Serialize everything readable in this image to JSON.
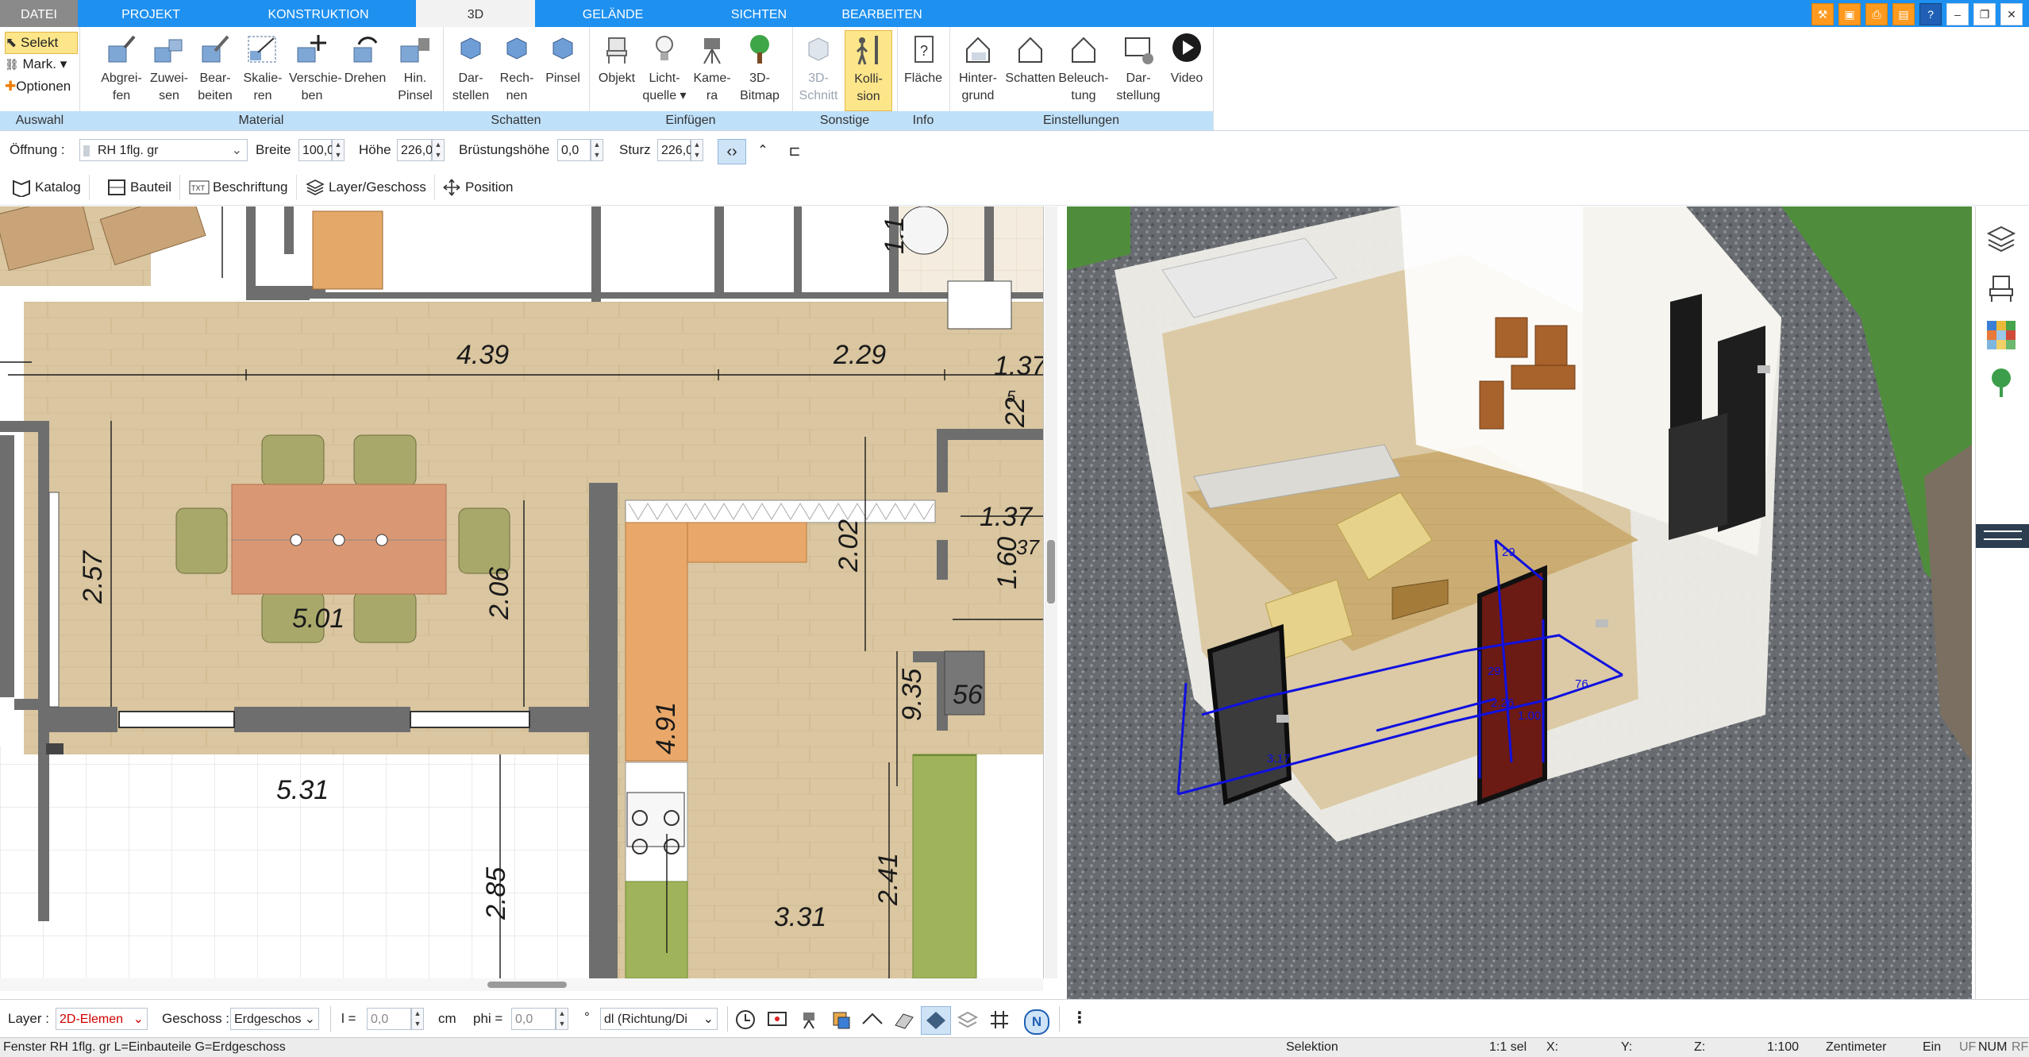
{
  "tabs": [
    "DATEI",
    "PROJEKT",
    "KONSTRUKTION",
    "3D",
    "GELÄNDE",
    "SICHTEN",
    "BEARBEITEN"
  ],
  "active_tab": "3D",
  "ribbon": {
    "auswahl": {
      "title": "Auswahl",
      "items": [
        "Selekt",
        "Mark.",
        "Optionen"
      ]
    },
    "material": {
      "title": "Material",
      "buttons": [
        {
          "l1": "Abgrei-",
          "l2": "fen"
        },
        {
          "l1": "Zuwei-",
          "l2": "sen"
        },
        {
          "l1": "Bear-",
          "l2": "beiten"
        },
        {
          "l1": "Skalie-",
          "l2": "ren"
        },
        {
          "l1": "Verschie-",
          "l2": "ben"
        },
        {
          "l1": "Drehen",
          "l2": ""
        },
        {
          "l1": "Hin.",
          "l2": "Pinsel"
        }
      ]
    },
    "schatten": {
      "title": "Schatten",
      "buttons": [
        {
          "l1": "Dar-",
          "l2": "stellen"
        },
        {
          "l1": "Rech-",
          "l2": "nen"
        },
        {
          "l1": "Pinsel",
          "l2": ""
        }
      ]
    },
    "einfuegen": {
      "title": "Einfügen",
      "buttons": [
        {
          "l1": "Objekt",
          "l2": ""
        },
        {
          "l1": "Licht-",
          "l2": "quelle ▾"
        },
        {
          "l1": "Kame-",
          "l2": "ra"
        },
        {
          "l1": "3D-",
          "l2": "Bitmap"
        }
      ]
    },
    "sonstige": {
      "title": "Sonstige",
      "buttons": [
        {
          "l1": "3D-",
          "l2": "Schnitt"
        },
        {
          "l1": "Kolli-",
          "l2": "sion"
        }
      ]
    },
    "info": {
      "title": "Info",
      "buttons": [
        {
          "l1": "Fläche",
          "l2": ""
        }
      ]
    },
    "einstellungen": {
      "title": "Einstellungen",
      "buttons": [
        {
          "l1": "Hinter-",
          "l2": "grund"
        },
        {
          "l1": "Schatten",
          "l2": ""
        },
        {
          "l1": "Beleuch-",
          "l2": "tung"
        },
        {
          "l1": "Dar-",
          "l2": "stellung"
        },
        {
          "l1": "Video",
          "l2": ""
        }
      ]
    }
  },
  "optbar": {
    "oeffnung_label": "Öffnung :",
    "oeffnung_value": "RH 1flg. gr",
    "breite_label": "Breite",
    "breite_value": "100,0",
    "hoehe_label": "Höhe",
    "hoehe_value": "226,0",
    "bruestung_label": "Brüstungshöhe",
    "bruestung_value": "0,0",
    "sturz_label": "Sturz",
    "sturz_value": "226,0"
  },
  "toolbar2": [
    "Katalog",
    "Bauteil",
    "Beschriftung",
    "Layer/Geschoss",
    "Position"
  ],
  "plan_dims": {
    "d1": "4.39",
    "d2": "2.29",
    "d3": "1.37",
    "d4": "2.57",
    "d5": "5.01",
    "d6": "2.06",
    "d7": "2.02",
    "d8": "1.37",
    "d9": "1.60",
    "d10": "5.31",
    "d11": "4.91",
    "d12": "9.35",
    "d13": "56",
    "d14": "2.85",
    "d15": "2.41",
    "d16": "3.31",
    "d17": "22",
    "d18": "5",
    "d19": "37",
    "d20": "1.1"
  },
  "view3d_dims": {
    "a": "3.17",
    "b": "1.00",
    "c": "2.26",
    "d": "29",
    "e": "76",
    "f": "29"
  },
  "bottom": {
    "layer_label": "Layer :",
    "layer_value": "2D-Elemen",
    "geschoss_label": "Geschoss :",
    "geschoss_value": "Erdgeschos",
    "l_label": "l =",
    "l_value": "0,0",
    "cm": "cm",
    "phi_label": "phi =",
    "phi_value": "0,0",
    "deg": "°",
    "dl_value": "dl (Richtung/Di"
  },
  "status": {
    "left": "Fenster RH 1flg. gr L=Einbauteile G=Erdgeschoss",
    "mode": "Selektion",
    "sel": "1:1 sel",
    "x": "X:",
    "y": "Y:",
    "z": "Z:",
    "scale": "1:100",
    "unit": "Zentimeter",
    "ein": "Ein",
    "uf": "UF",
    "num": "NUM",
    "rf": "RF"
  },
  "colors": {
    "tab_blue": "#1e90f0",
    "group_title": "#bfe0f9",
    "active_btn": "#fde68a",
    "dim_line": "#1a1a1a",
    "collision_box": "#1010e0",
    "floor_wood": "#dcc7a1"
  }
}
